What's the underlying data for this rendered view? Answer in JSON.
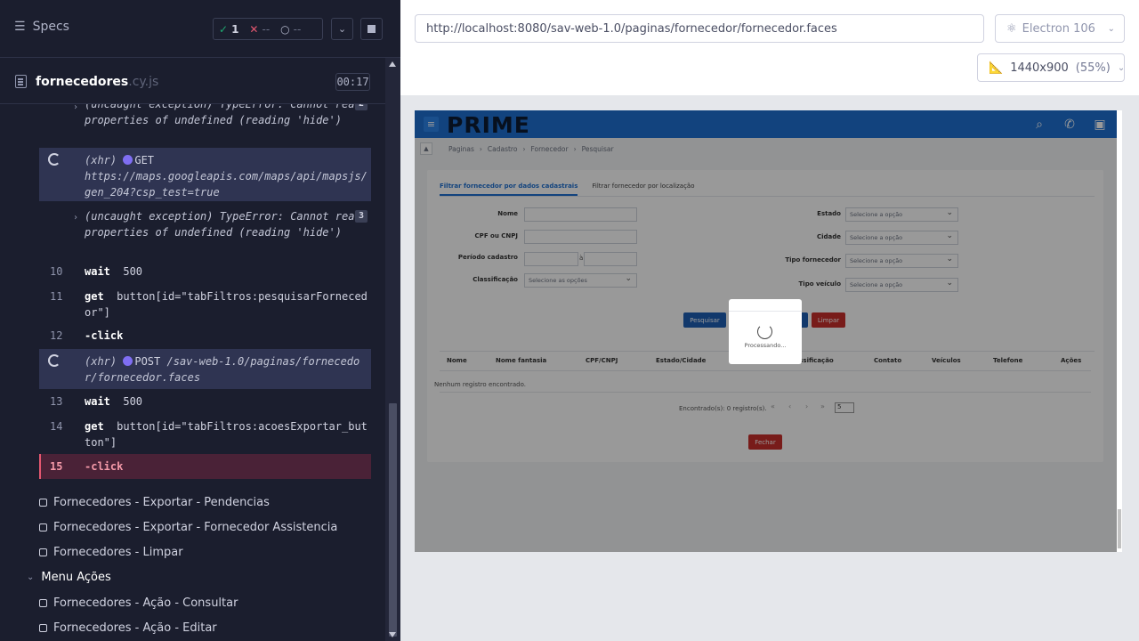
{
  "reporter": {
    "specs_label": "Specs",
    "stats": {
      "passed": "1",
      "failed": "--",
      "pending": "--"
    },
    "file": {
      "name": "fornecedores",
      "ext": ".cy.js",
      "duration": "00:17"
    },
    "commands": [
      {
        "num": "",
        "text": "(uncaught exception)  TypeError: Cannot read properties of undefined (reading 'hide')",
        "badge": "2"
      },
      {
        "num": "",
        "method": "(xhr)",
        "verb": "GET",
        "text": "https://maps.googleapis.com/maps/api/mapsjs/gen_204?csp_test=true"
      },
      {
        "num": "",
        "text": "(uncaught exception)  TypeError: Cannot read properties of undefined (reading 'hide')",
        "badge": "3"
      },
      {
        "num": "10",
        "name": "wait",
        "text": "500"
      },
      {
        "num": "11",
        "name": "get",
        "text": "button[id=\"tabFiltros:pesquisarFornecedor\"]"
      },
      {
        "num": "12",
        "name": "-click",
        "text": ""
      },
      {
        "num": "",
        "method": "(xhr)",
        "verb": "POST",
        "text": "/sav-web-1.0/paginas/fornecedor/fornecedor.faces"
      },
      {
        "num": "13",
        "name": "wait",
        "text": "500"
      },
      {
        "num": "14",
        "name": "get",
        "text": "button[id=\"tabFiltros:acoesExportar_button\"]"
      },
      {
        "num": "15",
        "name": "-click",
        "text": ""
      }
    ],
    "tests": [
      "Fornecedores - Exportar - Pendencias",
      "Fornecedores - Exportar - Fornecedor Assistencia",
      "Fornecedores - Limpar"
    ],
    "suite": "Menu Ações",
    "suite_tests": [
      "Fornecedores - Ação - Consultar",
      "Fornecedores - Ação - Editar"
    ]
  },
  "runner": {
    "url": "http://localhost:8080/sav-web-1.0/paginas/fornecedor/fornecedor.faces",
    "browser": "Electron 106",
    "viewport": "1440x900",
    "zoom": "(55%)"
  },
  "aut": {
    "logo": "PRIME",
    "breadcrumb": [
      "Paginas",
      "Cadastro",
      "Fornecedor",
      "Pesquisar"
    ],
    "tabs": [
      "Filtrar fornecedor por dados cadastrais",
      "Filtrar fornecedor por localização"
    ],
    "labels": {
      "nome": "Nome",
      "cpf": "CPF ou CNPJ",
      "periodo": "Período cadastro",
      "classificacao": "Classificação",
      "estado": "Estado",
      "cidade": "Cidade",
      "tipo_fornecedor": "Tipo fornecedor",
      "tipo_veiculo": "Tipo veículo",
      "ate": "à"
    },
    "select_placeholder": "Selecione a opção",
    "multi_placeholder": "Selecione as opções",
    "buttons": {
      "pesquisar": "Pesquisar",
      "limpar": "Limpar",
      "fechar": "Fechar"
    },
    "table_headers": [
      "Nome",
      "Nome fantasia",
      "CPF/CNPJ",
      "Estado/Cidade",
      "Classificação",
      "Contato",
      "Veículos",
      "Telefone",
      "Ações"
    ],
    "empty_message": "Nenhum registro encontrado.",
    "pager_text": "Encontrado(s): 0 registro(s).",
    "rows_per_page": "5",
    "loader_text": "Processando...",
    "colors": {
      "nav": "#1e71d3",
      "primary_btn": "#1e5fb4",
      "danger_btn": "#c9302c"
    }
  }
}
